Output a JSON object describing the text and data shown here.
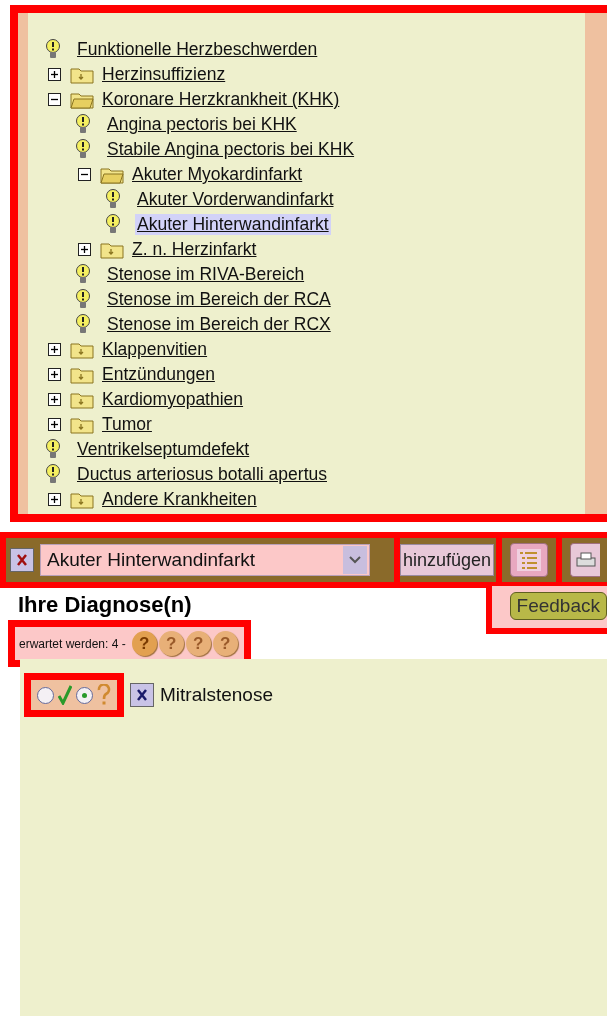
{
  "tree": [
    {
      "kind": "leaf",
      "label": "Funktionelle Herzbeschwerden",
      "selected": false
    },
    {
      "kind": "folder",
      "label": "Herzinsuffizienz",
      "expanded": false,
      "selected": false
    },
    {
      "kind": "folder",
      "label": "Koronare Herzkrankheit (KHK)",
      "expanded": true,
      "selected": false,
      "children": [
        {
          "kind": "leaf",
          "label": "Angina pectoris bei KHK",
          "selected": false
        },
        {
          "kind": "leaf",
          "label": "Stabile Angina pectoris bei KHK",
          "selected": false
        },
        {
          "kind": "folder",
          "label": "Akuter Myokardinfarkt",
          "expanded": true,
          "selected": false,
          "children": [
            {
              "kind": "leaf",
              "label": "Akuter Vorderwandinfarkt",
              "selected": false
            },
            {
              "kind": "leaf",
              "label": "Akuter Hinterwandinfarkt",
              "selected": true
            }
          ]
        },
        {
          "kind": "folder",
          "label": "Z. n. Herzinfarkt",
          "expanded": false,
          "selected": false
        },
        {
          "kind": "leaf",
          "label": "Stenose im RIVA-Bereich",
          "selected": false
        },
        {
          "kind": "leaf",
          "label": "Stenose im Bereich der RCA",
          "selected": false
        },
        {
          "kind": "leaf",
          "label": "Stenose im Bereich der RCX",
          "selected": false
        }
      ]
    },
    {
      "kind": "folder",
      "label": "Klappenvitien",
      "expanded": false,
      "selected": false
    },
    {
      "kind": "folder",
      "label": "Entzündungen",
      "expanded": false,
      "selected": false
    },
    {
      "kind": "folder",
      "label": "Kardiomyopathien",
      "expanded": false,
      "selected": false
    },
    {
      "kind": "folder",
      "label": "Tumor",
      "expanded": false,
      "selected": false
    },
    {
      "kind": "leaf",
      "label": "Ventrikelseptumdefekt",
      "selected": false
    },
    {
      "kind": "leaf",
      "label": "Ductus arteriosus botalli apertus",
      "selected": false
    },
    {
      "kind": "folder",
      "label": "Andere Krankheiten",
      "expanded": false,
      "selected": false
    }
  ],
  "toolbar": {
    "select_value": "Akuter Hinterwandinfarkt",
    "add_button": "hinzufügen"
  },
  "diagnoses_title": "Ihre Diagnose(n)",
  "feedback_button": "Feedback",
  "expected": {
    "label": "erwartet werden: 4 -",
    "markers": [
      "?",
      "?",
      "?",
      "?"
    ]
  },
  "diagnoses": [
    {
      "name": "Mitralstenose",
      "options": [
        {
          "kind": "correct",
          "selected": false
        },
        {
          "kind": "unsure",
          "selected": true
        }
      ]
    }
  ]
}
